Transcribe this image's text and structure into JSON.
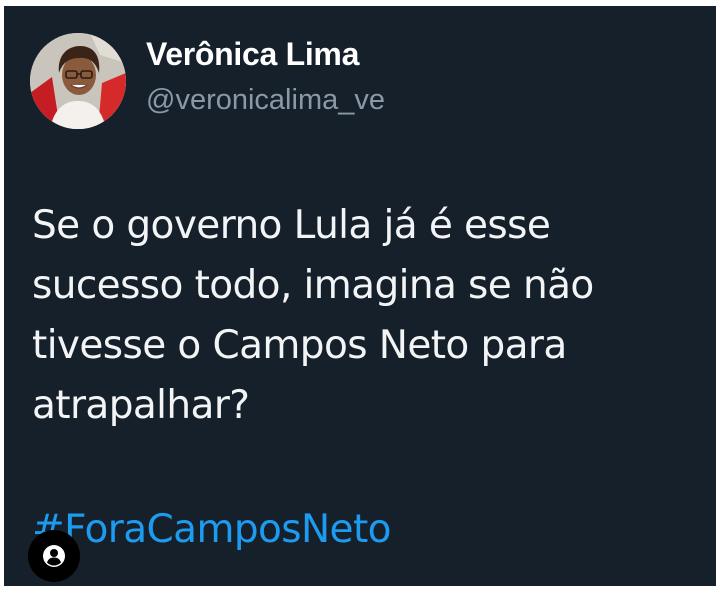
{
  "tweet": {
    "author": {
      "display_name": "Verônica Lima",
      "handle": "@veronicalima_ve",
      "avatar_icon": "profile-photo"
    },
    "text_lines": [
      "Se o governo Lula já é esse",
      "sucesso todo, imagina se não",
      "tivesse o Campos Neto para",
      "atrapalhar?"
    ],
    "hashtag": "#ForaCamposNeto"
  },
  "overlay": {
    "profile_button_icon": "user-circle-icon"
  },
  "colors": {
    "background": "#15202b",
    "text": "#f2f4f5",
    "handle": "#8b98a5",
    "hashtag": "#1d9bf0"
  }
}
